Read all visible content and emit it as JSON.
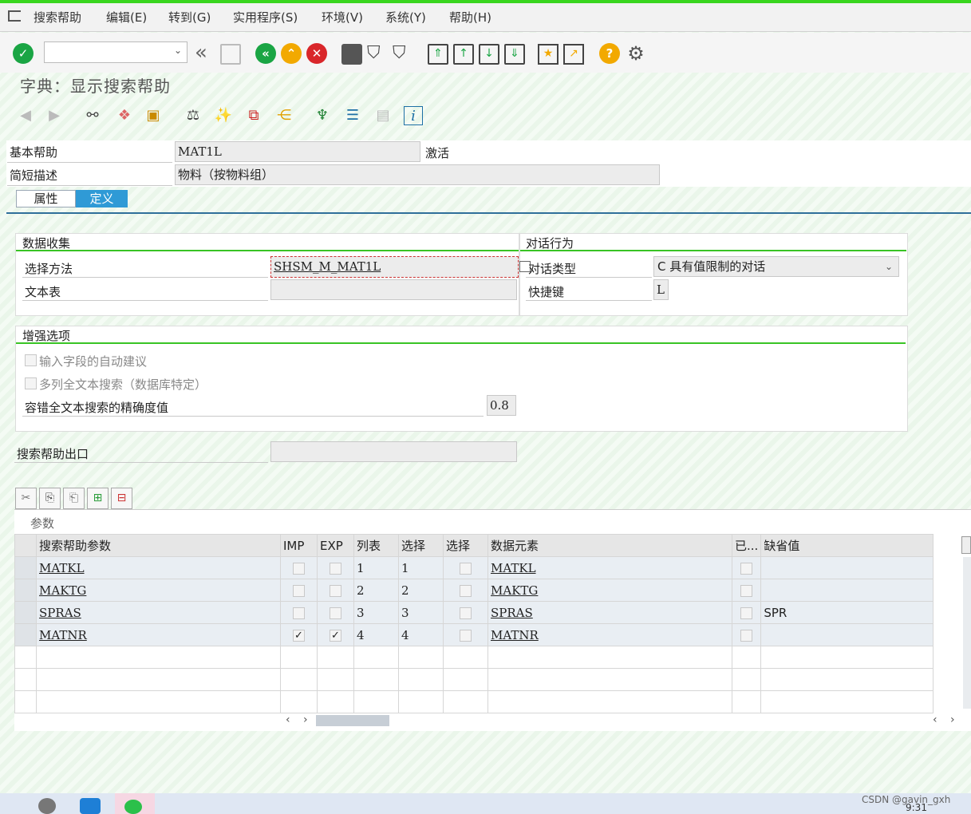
{
  "menu": [
    "搜索帮助",
    "编辑(E)",
    "转到(G)",
    "实用程序(S)",
    "环境(V)",
    "系统(Y)",
    "帮助(H)"
  ],
  "title": "字典：显示搜索帮助",
  "header": {
    "basic_help_label": "基本帮助",
    "basic_help_value": "MAT1L",
    "status": "激活",
    "short_desc_label": "简短描述",
    "short_desc_value": "物料（按物料组）"
  },
  "tabs": [
    "属性",
    "定义"
  ],
  "data_collection": {
    "title": "数据收集",
    "method_label": "选择方法",
    "method_value": "SHSM_M_MAT1L",
    "text_table_label": "文本表",
    "text_table_value": ""
  },
  "dialog": {
    "title": "对话行为",
    "type_label": "对话类型",
    "type_value": "C 具有值限制的对话",
    "hotkey_label": "快捷键",
    "hotkey_value": "L"
  },
  "enhanced": {
    "title": "增强选项",
    "opt1": "输入字段的自动建议",
    "opt2": "多列全文本搜索（数据库特定）",
    "accuracy_label": "容错全文本搜索的精确度值",
    "accuracy_value": "0.8"
  },
  "exit": {
    "label": "搜索帮助出口",
    "value": ""
  },
  "params": {
    "title": "参数",
    "headers": [
      "搜索帮助参数",
      "IMP",
      "EXP",
      "列表",
      "选择",
      "选择",
      "数据元素",
      "已...",
      "缺省值"
    ],
    "rows": [
      {
        "name": "MATKL",
        "imp": false,
        "exp": false,
        "list": "1",
        "sel": "1",
        "de": "MATKL",
        "def": ""
      },
      {
        "name": "MAKTG",
        "imp": false,
        "exp": false,
        "list": "2",
        "sel": "2",
        "de": "MAKTG",
        "def": ""
      },
      {
        "name": "SPRAS",
        "imp": false,
        "exp": false,
        "list": "3",
        "sel": "3",
        "de": "SPRAS",
        "def": "SPR"
      },
      {
        "name": "MATNR",
        "imp": true,
        "exp": true,
        "list": "4",
        "sel": "4",
        "de": "MATNR",
        "def": ""
      }
    ]
  },
  "footer": {
    "watermark": "CSDN @gavin_gxh",
    "time": "9:31"
  },
  "colors": {
    "accent": "#2f9ad6",
    "green": "#39c425"
  }
}
